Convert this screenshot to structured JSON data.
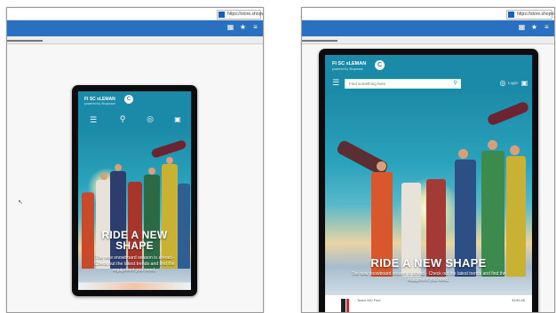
{
  "left": {
    "window": {
      "tab_label": "https://store.shopware",
      "icons": [
        "share-icon",
        "star-icon",
        "menu-icon"
      ],
      "progress_fraction": 0.14
    },
    "logo": {
      "name": "FI SC xLEMAN",
      "tagline": "powered by Shopware"
    },
    "nav_icons": [
      "hamburger-icon",
      "search-icon",
      "location-pin-icon",
      "cart-icon"
    ],
    "hero": {
      "title_line1": "RIDE A NEW",
      "title_line2": "SHAPE",
      "subtitle_line1": "The new snowboard season is ahead -",
      "subtitle_line2": "Check out the latest trends and find the",
      "subtitle_line3": "equipment you need."
    }
  },
  "right": {
    "window": {
      "tab_label": "https://store.shopware",
      "icons": [
        "share-icon",
        "star-icon",
        "menu-icon"
      ],
      "progress_fraction": 0.14
    },
    "logo": {
      "name": "FI SC xLEMAN",
      "tagline": "powered by Shopware"
    },
    "search": {
      "placeholder": "Find something here"
    },
    "header_right": {
      "label": "Login"
    },
    "hero": {
      "title": "RIDE A NEW SHAPE",
      "subtitle": "The new snowboard season is ahead - Check out the latest trends and find the equipment you need."
    },
    "product": {
      "name": "Team 100 Fine",
      "price": "€199,95"
    }
  },
  "colors": {
    "browser_bar": "#2a70c0",
    "shop_teal": "#1b8aa8",
    "device_frame": "#0c0c0e"
  }
}
